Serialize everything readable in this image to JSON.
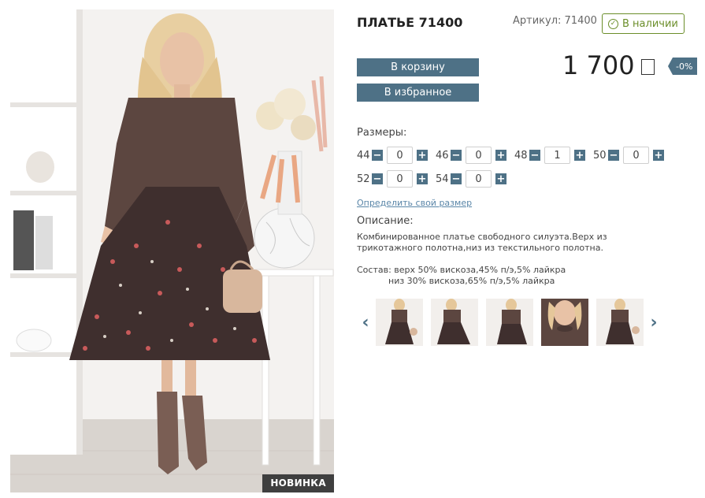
{
  "product": {
    "title": "ПЛАТЬЕ 71400",
    "article": "Артикул: 71400",
    "stock": "В наличии",
    "price": "1 700",
    "discount": "-0%",
    "badge": "НОВИНКА"
  },
  "buttons": {
    "cart": "В корзину",
    "favorites": "В избранное"
  },
  "sizes": {
    "label": "Размеры:",
    "items": [
      {
        "size": "44",
        "qty": "0"
      },
      {
        "size": "46",
        "qty": "0"
      },
      {
        "size": "48",
        "qty": "1"
      },
      {
        "size": "50",
        "qty": "0"
      },
      {
        "size": "52",
        "qty": "0"
      },
      {
        "size": "54",
        "qty": "0"
      }
    ],
    "minus": "−",
    "plus": "+"
  },
  "size_link": "Определить свой размер",
  "description": {
    "label": "Описание:",
    "text": "Комбинированное платье свободного силуэта.Верх из трикотажного полотна,низ из текстильного полотна.",
    "composition_line1": "Состав: верх 50% вискоза,45% п/э,5% лайкра",
    "composition_line2": "низ 30% вискоза,65% п/э,5% лайкра"
  },
  "gallery": {
    "prev": "‹",
    "next": "›"
  },
  "icons": {
    "stock": "check-circle-icon",
    "currency": "ruble-icon",
    "prev": "chevron-left-icon",
    "next": "chevron-right-icon"
  },
  "colors": {
    "accent": "#4e7186",
    "stock_green": "#6b8e2a",
    "badge_bg": "#3f3f3f",
    "link": "#5a86a8"
  }
}
